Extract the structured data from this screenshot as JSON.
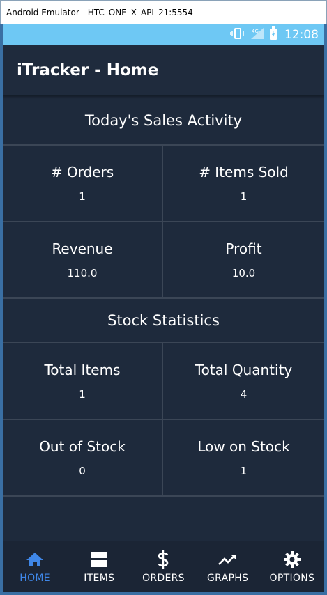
{
  "window": {
    "title": "Android Emulator - HTC_ONE_X_API_21:5554"
  },
  "status_bar": {
    "network": "4G",
    "time": "12:08"
  },
  "app_bar": {
    "title": "iTracker - Home"
  },
  "sales": {
    "title": "Today's Sales Activity",
    "stats": [
      {
        "label": "# Orders",
        "value": "1"
      },
      {
        "label": "# Items Sold",
        "value": "1"
      },
      {
        "label": "Revenue",
        "value": "110.0"
      },
      {
        "label": "Profit",
        "value": "10.0"
      }
    ]
  },
  "stock": {
    "title": "Stock Statistics",
    "stats": [
      {
        "label": "Total Items",
        "value": "1"
      },
      {
        "label": "Total Quantity",
        "value": "4"
      },
      {
        "label": "Out of Stock",
        "value": "0"
      },
      {
        "label": "Low on Stock",
        "value": "1"
      }
    ]
  },
  "nav": {
    "items": [
      {
        "label": "HOME",
        "icon": "home-icon",
        "active": true
      },
      {
        "label": "ITEMS",
        "icon": "items-icon",
        "active": false
      },
      {
        "label": "ORDERS",
        "icon": "dollar-icon",
        "active": false
      },
      {
        "label": "GRAPHS",
        "icon": "trending-icon",
        "active": false
      },
      {
        "label": "OPTIONS",
        "icon": "gear-icon",
        "active": false
      }
    ]
  },
  "colors": {
    "accent": "#3f87e8",
    "background": "#1e2a3c",
    "status_bar": "#6ec8f4"
  }
}
